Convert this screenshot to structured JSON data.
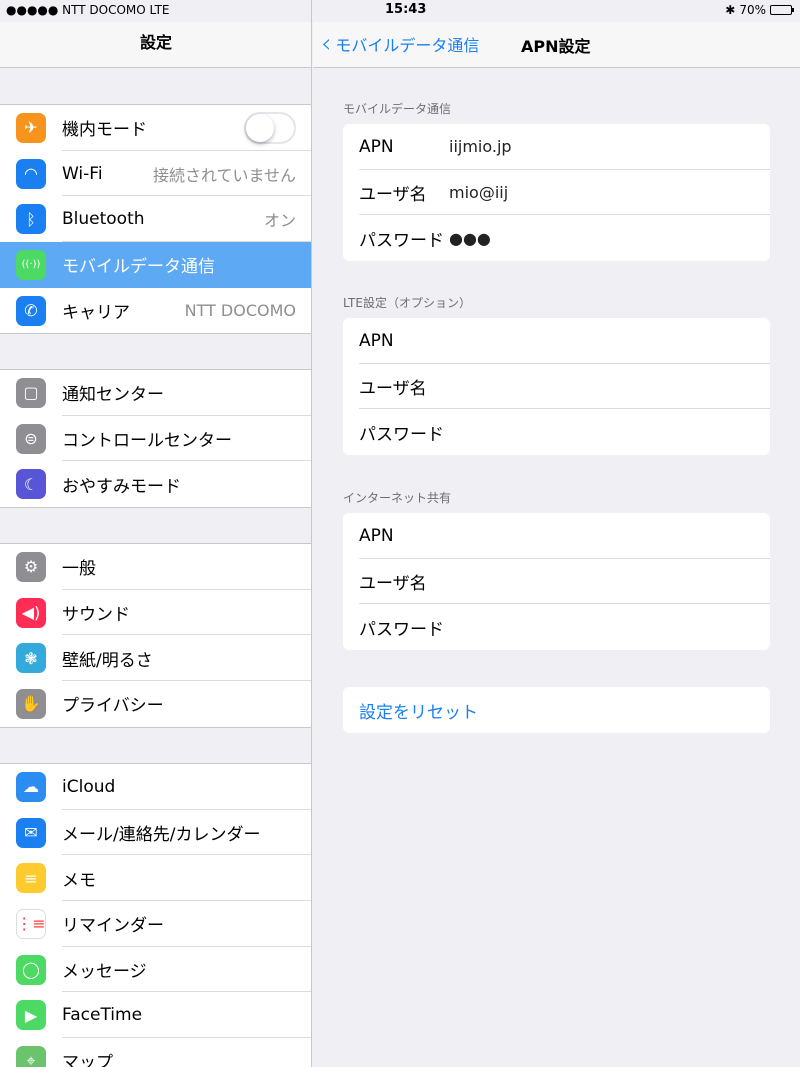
{
  "status": {
    "carrier": "●●●●● NTT DOCOMO  LTE",
    "time": "15:43",
    "battery": "70%",
    "battery_level": 0.7
  },
  "left": {
    "title": "設定",
    "groups": [
      [
        {
          "label": "機内モード",
          "icon": "airplane-icon",
          "color": "#f7941d",
          "toggle": true
        },
        {
          "label": "Wi-Fi",
          "icon": "wifi-icon",
          "color": "#1a7ff0",
          "value": "接続されていません"
        },
        {
          "label": "Bluetooth",
          "icon": "bluetooth-icon",
          "color": "#1a7ff0",
          "value": "オン"
        },
        {
          "label": "モバイルデータ通信",
          "icon": "cellular-icon",
          "color": "#4cd964",
          "selected": true
        },
        {
          "label": "キャリア",
          "icon": "phone-icon",
          "color": "#1a7ff0",
          "value": "NTT DOCOMO"
        }
      ],
      [
        {
          "label": "通知センター",
          "icon": "notification-icon",
          "color": "#8e8e93"
        },
        {
          "label": "コントロールセンター",
          "icon": "control-center-icon",
          "color": "#8e8e93"
        },
        {
          "label": "おやすみモード",
          "icon": "moon-icon",
          "color": "#5856d6"
        }
      ],
      [
        {
          "label": "一般",
          "icon": "gear-icon",
          "color": "#8e8e93"
        },
        {
          "label": "サウンド",
          "icon": "speaker-icon",
          "color": "#ff2d55"
        },
        {
          "label": "壁紙/明るさ",
          "icon": "wallpaper-icon",
          "color": "#34aadc"
        },
        {
          "label": "プライバシー",
          "icon": "hand-icon",
          "color": "#8e8e93"
        }
      ],
      [
        {
          "label": "iCloud",
          "icon": "cloud-icon",
          "color": "#2b8df2"
        },
        {
          "label": "メール/連絡先/カレンダー",
          "icon": "mail-icon",
          "color": "#1a7ff0"
        },
        {
          "label": "メモ",
          "icon": "notes-icon",
          "color": "#fecb2f"
        },
        {
          "label": "リマインダー",
          "icon": "reminders-icon",
          "color": "#ffffff"
        },
        {
          "label": "メッセージ",
          "icon": "messages-icon",
          "color": "#4cd964"
        },
        {
          "label": "FaceTime",
          "icon": "facetime-icon",
          "color": "#4cd964"
        },
        {
          "label": "マップ",
          "icon": "maps-icon",
          "color": "#6bc36b"
        }
      ]
    ]
  },
  "right": {
    "back_label": "モバイルデータ通信",
    "title": "APN設定",
    "sections": [
      {
        "header": "モバイルデータ通信",
        "fields": [
          {
            "label": "APN",
            "value": "iijmio.jp"
          },
          {
            "label": "ユーザ名",
            "value": "mio@iij"
          },
          {
            "label": "パスワード",
            "value": "●●●"
          }
        ]
      },
      {
        "header": "LTE設定（オプション）",
        "fields": [
          {
            "label": "APN",
            "value": ""
          },
          {
            "label": "ユーザ名",
            "value": ""
          },
          {
            "label": "パスワード",
            "value": ""
          }
        ]
      },
      {
        "header": "インターネット共有",
        "fields": [
          {
            "label": "APN",
            "value": ""
          },
          {
            "label": "ユーザ名",
            "value": ""
          },
          {
            "label": "パスワード",
            "value": ""
          }
        ]
      }
    ],
    "reset_label": "設定をリセット"
  }
}
